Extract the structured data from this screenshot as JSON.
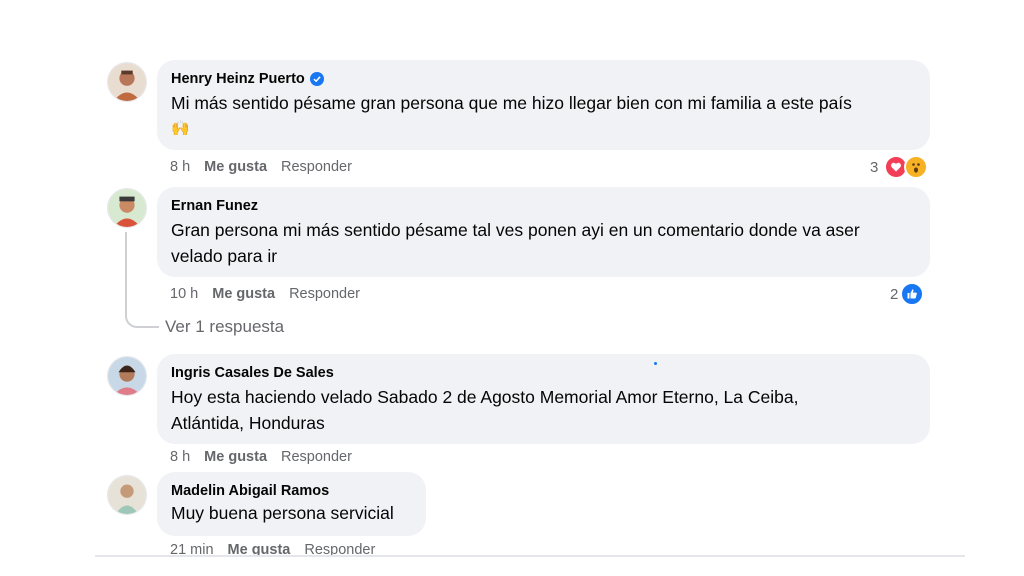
{
  "comments": [
    {
      "author": "Henry Heinz Puerto",
      "verified": true,
      "text": "Mi más sentido pésame gran persona que me hizo llegar bien con mi familia a este país",
      "emoji": "🙌",
      "time": "8 h",
      "like_label": "Me gusta",
      "reply_label": "Responder",
      "reaction_count": "3",
      "reactions": [
        "love-icon",
        "wow-icon"
      ]
    },
    {
      "author": "Ernan Funez",
      "verified": false,
      "text": "Gran persona mi más sentido pésame tal ves ponen ayi en un comentario donde va aser",
      "text2": "velado para ir",
      "time": "10 h",
      "like_label": "Me gusta",
      "reply_label": "Responder",
      "reaction_count": "2",
      "reactions": [
        "like-icon"
      ],
      "view_replies": "Ver 1 respuesta"
    },
    {
      "author": "Ingris Casales De Sales",
      "verified": false,
      "text": "Hoy esta haciendo velado Sabado 2 de Agosto Memorial Amor Eterno, La Ceiba,",
      "text2": "Atlántida, Honduras",
      "time": "8 h",
      "like_label": "Me gusta",
      "reply_label": "Responder"
    },
    {
      "author": "Madelin Abigail Ramos",
      "verified": false,
      "text": "Muy buena persona servicial",
      "time": "21 min",
      "like_label": "Me gusta",
      "reply_label": "Responder"
    }
  ],
  "colors": {
    "bubble": "#f0f2f5",
    "secondary_text": "#65676b",
    "facebook_blue": "#1877f2",
    "love_red": "#f33e58",
    "wow_yellow": "#f7b125"
  }
}
